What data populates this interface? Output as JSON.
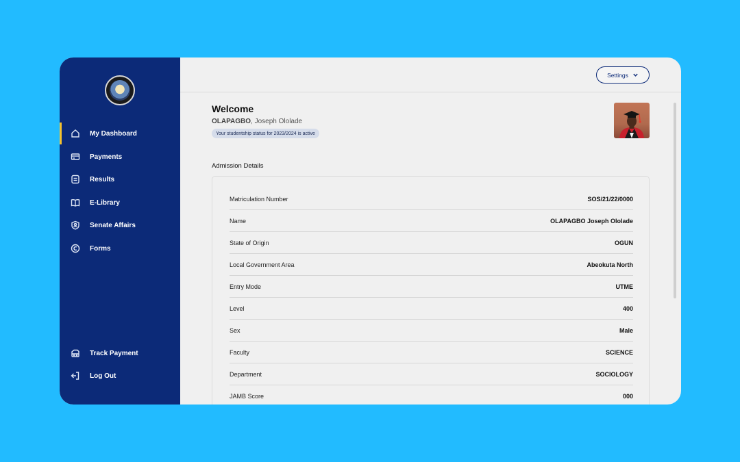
{
  "sidebar": {
    "items": [
      {
        "label": "My Dashboard",
        "icon": "home-icon"
      },
      {
        "label": "Payments",
        "icon": "credit-card-icon"
      },
      {
        "label": "Results",
        "icon": "document-icon"
      },
      {
        "label": "E-Library",
        "icon": "book-icon"
      },
      {
        "label": "Senate Affairs",
        "icon": "user-badge-icon"
      },
      {
        "label": "Forms",
        "icon": "form-icon"
      }
    ],
    "bottom_items": [
      {
        "label": "Track Payment",
        "icon": "track-payment-icon"
      },
      {
        "label": "Log Out",
        "icon": "logout-icon"
      }
    ]
  },
  "header": {
    "settings_label": "Settings"
  },
  "welcome": {
    "title": "Welcome",
    "surname": "OLAPAGBO",
    "other_names": ", Joseph Ololade",
    "status": "Your studentship status for 2023/2024 is active"
  },
  "admission": {
    "title": "Admission Details",
    "rows": [
      {
        "label": "Matriculation Number",
        "value": "SOS/21/22/0000"
      },
      {
        "label": "Name",
        "value": "OLAPAGBO Joseph Ololade"
      },
      {
        "label": "State of Origin",
        "value": "OGUN"
      },
      {
        "label": "Local Government Area",
        "value": "Abeokuta North"
      },
      {
        "label": "Entry Mode",
        "value": "UTME"
      },
      {
        "label": "Level",
        "value": "400"
      },
      {
        "label": "Sex",
        "value": "Male"
      },
      {
        "label": "Faculty",
        "value": "SCIENCE"
      },
      {
        "label": "Department",
        "value": "SOCIOLOGY"
      },
      {
        "label": "JAMB Score",
        "value": "000"
      }
    ]
  },
  "colors": {
    "background": "#22bbff",
    "sidebar": "#0c2a78",
    "active_indicator": "#f5c12e"
  }
}
